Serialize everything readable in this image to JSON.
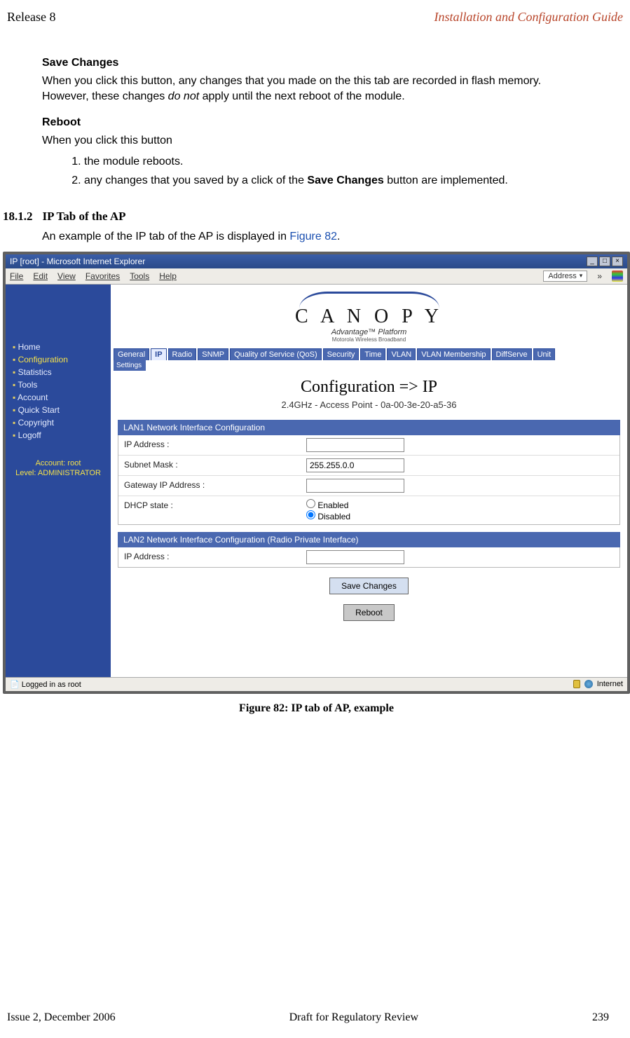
{
  "header": {
    "left": "Release 8",
    "right": "Installation and Configuration Guide"
  },
  "doc": {
    "save_h": "Save Changes",
    "save_p1": "When you click this button, any changes that you made on the this tab are recorded in flash memory. However, these changes ",
    "save_p1_ital": "do not",
    "save_p1_tail": " apply until the next reboot of the module.",
    "reboot_h": "Reboot",
    "reboot_p": "When you click this button",
    "li1": "the module reboots.",
    "li2a": "any changes that you saved by a click of the ",
    "li2b": "Save Changes",
    "li2c": " button are implemented.",
    "sec_num": "18.1.2",
    "sec_title": "IP Tab of the AP",
    "sec_p_a": "An example of the IP tab of the AP is displayed in ",
    "sec_p_link": "Figure 82",
    "sec_p_b": ".",
    "caption": "Figure 82: IP tab of AP, example"
  },
  "browser": {
    "title": "IP [root] - Microsoft Internet Explorer",
    "menus": [
      "File",
      "Edit",
      "View",
      "Favorites",
      "Tools",
      "Help"
    ],
    "address_label": "Address",
    "sidebar": {
      "items": [
        {
          "label": "Home",
          "active": false
        },
        {
          "label": "Configuration",
          "active": true
        },
        {
          "label": "Statistics",
          "active": false
        },
        {
          "label": "Tools",
          "active": false
        },
        {
          "label": "Account",
          "active": false
        },
        {
          "label": "Quick Start",
          "active": false
        },
        {
          "label": "Copyright",
          "active": false
        },
        {
          "label": "Logoff",
          "active": false
        }
      ],
      "acct1": "Account: root",
      "acct2": "Level: ADMINISTRATOR"
    },
    "logo": {
      "name": "C A N O P Y",
      "sub": "Advantage™ Platform",
      "sub2": "Motorola Wireless Broadband"
    },
    "tabs": [
      "General",
      "IP",
      "Radio",
      "SNMP",
      "Quality of Service (QoS)",
      "Security",
      "Time",
      "VLAN",
      "VLAN Membership",
      "DiffServe",
      "Unit"
    ],
    "active_tab": 1,
    "group": "Settings",
    "panel": {
      "title": "Configuration => IP",
      "device": "2.4GHz - Access Point - 0a-00-3e-20-a5-36",
      "fs1_title": "LAN1 Network Interface Configuration",
      "fs1_rows": {
        "ip_lbl": "IP Address :",
        "ip_val": "",
        "mask_lbl": "Subnet Mask :",
        "mask_val": "255.255.0.0",
        "gw_lbl": "Gateway IP Address :",
        "gw_val": "",
        "dhcp_lbl": "DHCP state :",
        "dhcp_en": "Enabled",
        "dhcp_dis": "Disabled"
      },
      "fs2_title": "LAN2 Network Interface Configuration (Radio Private Interface)",
      "fs2_rows": {
        "ip_lbl": "IP Address :",
        "ip_val": ""
      },
      "btn_save": "Save Changes",
      "btn_reboot": "Reboot"
    },
    "status_left": "Logged in as root",
    "status_right": "Internet"
  },
  "footer": {
    "left": "Issue 2, December 2006",
    "mid": "Draft for Regulatory Review",
    "right": "239"
  }
}
